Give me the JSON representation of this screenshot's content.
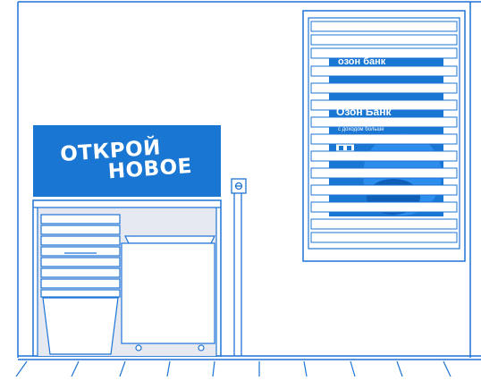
{
  "banner": {
    "line1": "ОТКРОЙ",
    "line2": "НОВОЕ"
  },
  "poster": {
    "brand": "озон банк",
    "headline": "Озон Банк",
    "caption": "с доходом больше"
  },
  "colors": {
    "primary_blue": "#1976d2",
    "line_blue": "#1e74d6",
    "light_fill": "#e6e9ef",
    "background": "#ffffff"
  },
  "icons": {
    "wall_socket": "socket-icon"
  }
}
